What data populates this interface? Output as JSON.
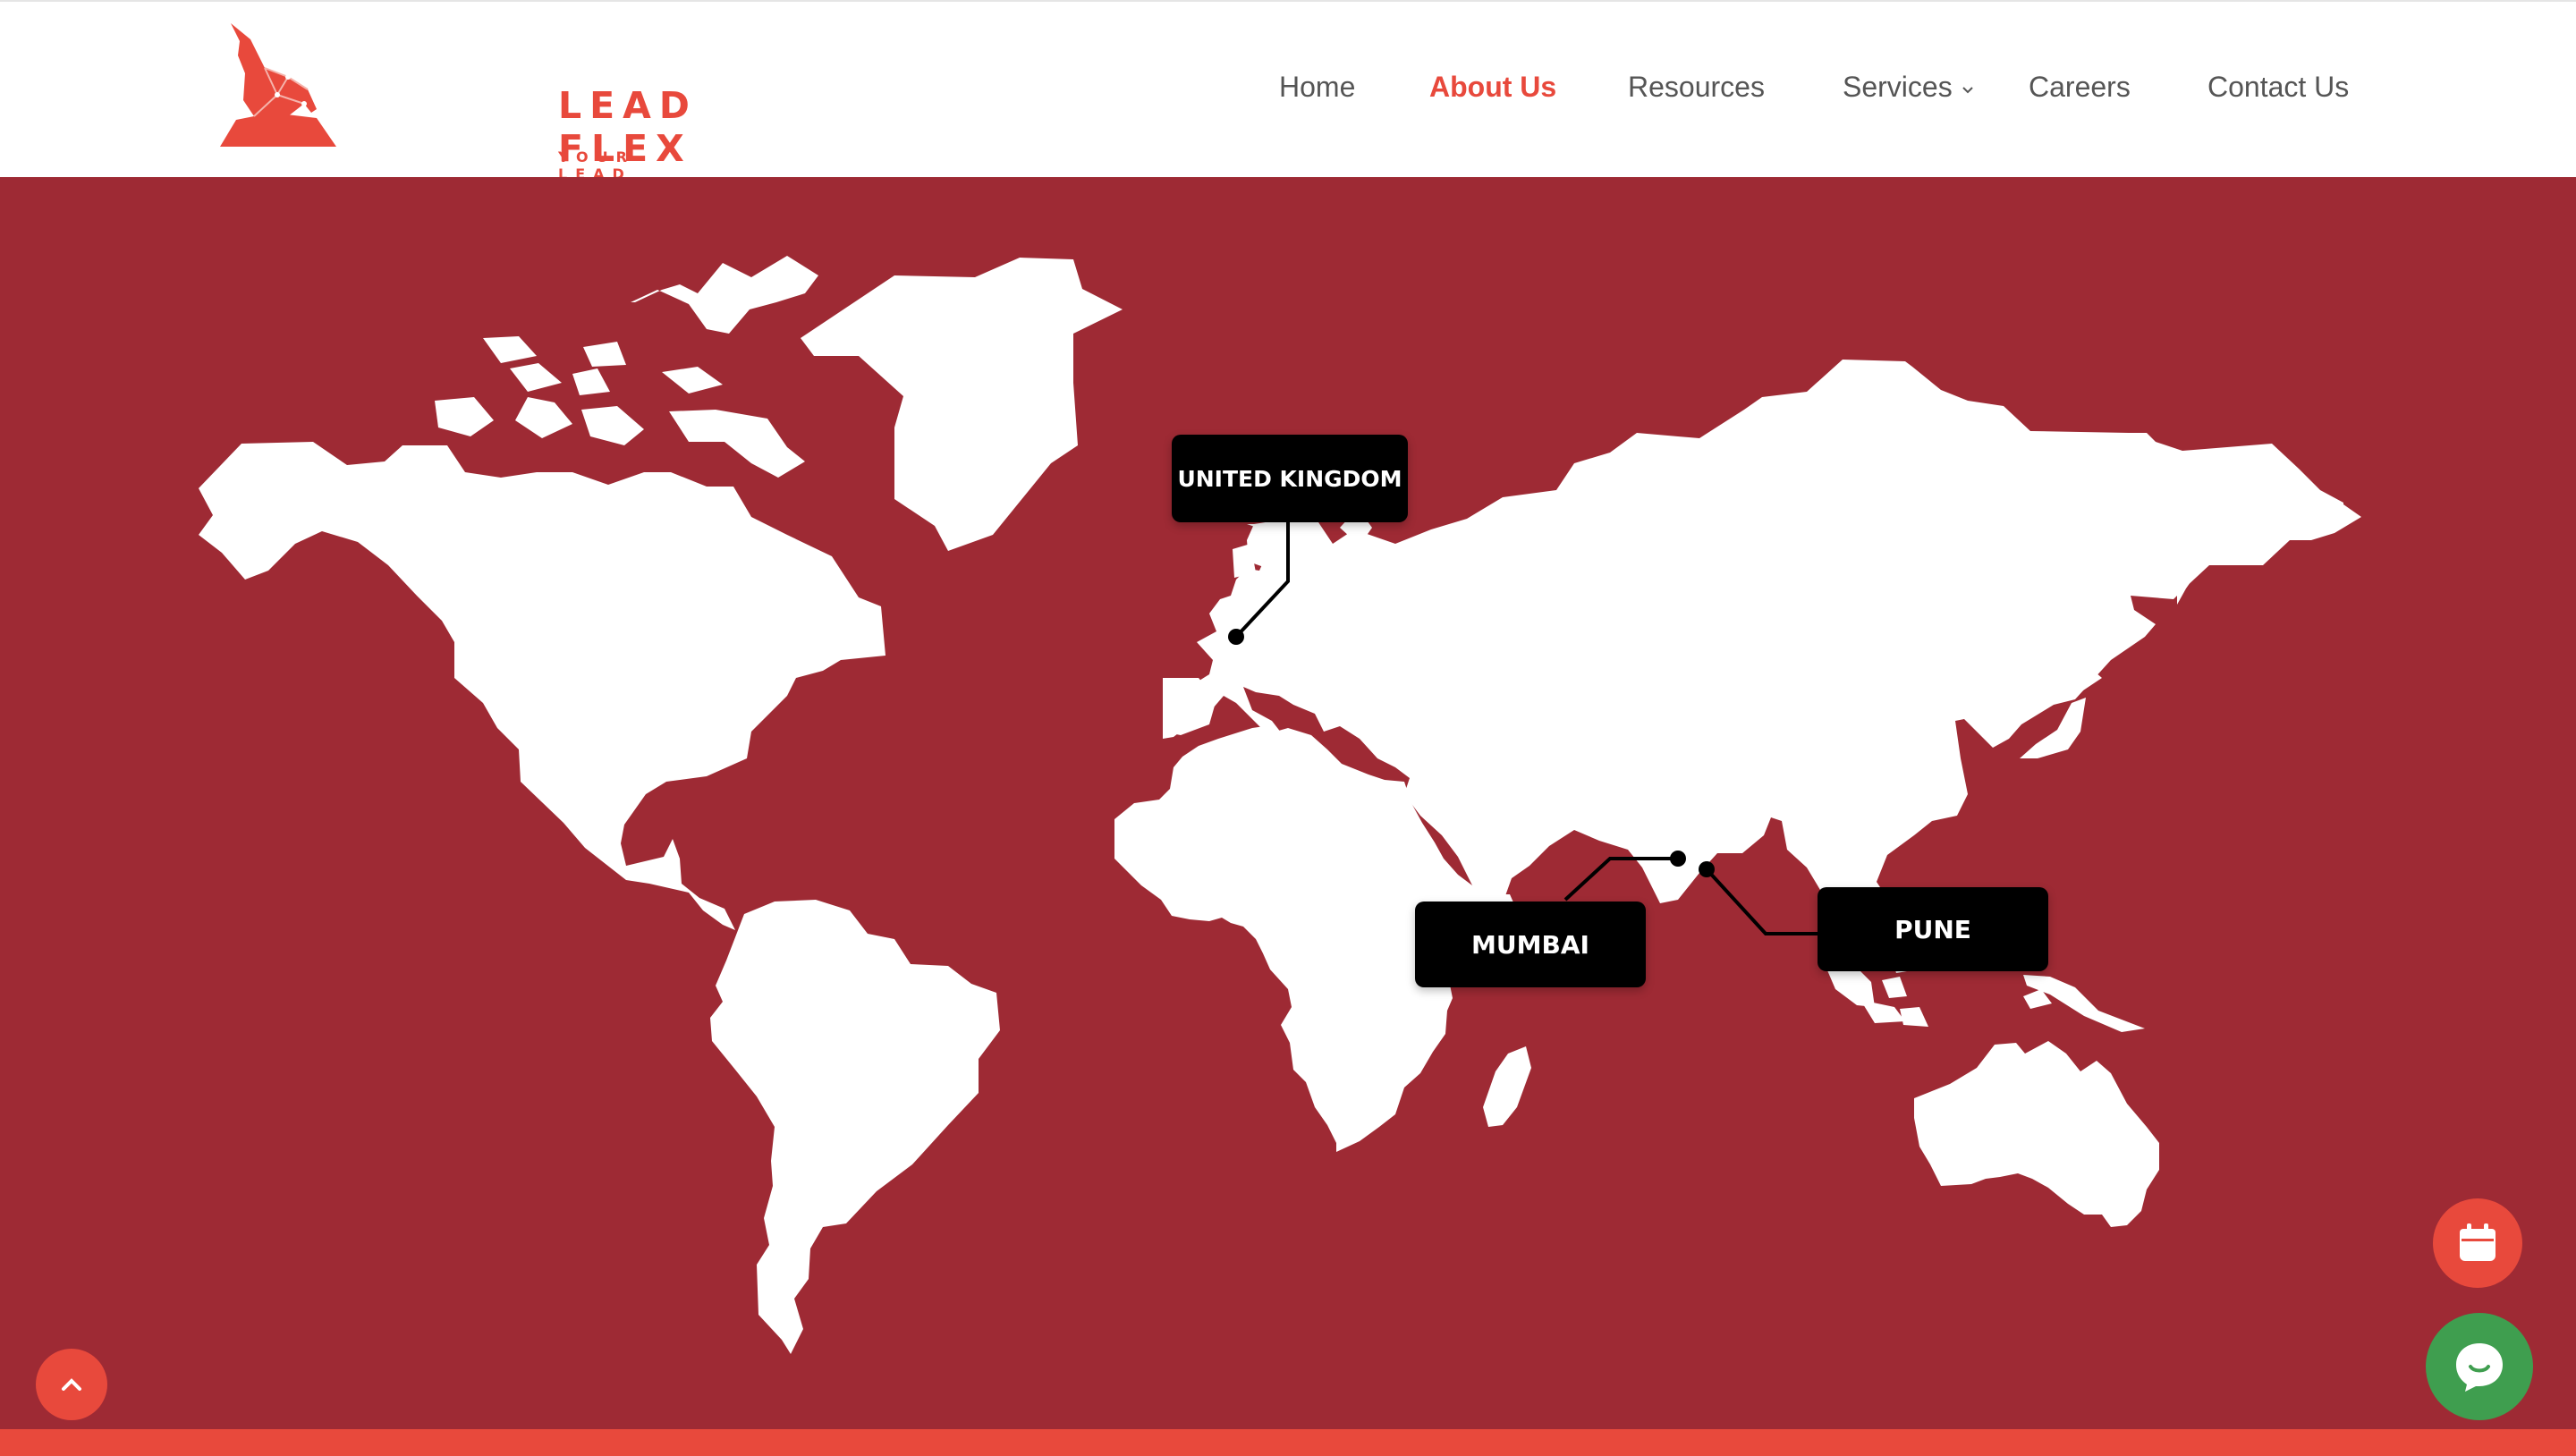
{
  "brand": {
    "name": "LEAD FLEX",
    "tagline": "YOUR LEAD PARTNER",
    "color": "#e8493c"
  },
  "nav": {
    "items": [
      {
        "label": "Home",
        "active": false
      },
      {
        "label": "About Us",
        "active": true
      },
      {
        "label": "Resources",
        "active": false
      },
      {
        "label": "Services",
        "active": false,
        "has_dropdown": true
      },
      {
        "label": "Careers",
        "active": false
      },
      {
        "label": "Contact Us",
        "active": false
      }
    ]
  },
  "map": {
    "background": "#9e2a34",
    "land_color": "#ffffff",
    "locations": [
      {
        "label": "UNITED KINGDOM"
      },
      {
        "label": "MUMBAI"
      },
      {
        "label": "PUNE"
      }
    ]
  },
  "fabs": {
    "scroll_top_icon": "chevron-up-icon",
    "calendar_icon": "calendar-icon",
    "chat_icon": "chat-bubble-icon",
    "chat_color": "#3f9e4f"
  }
}
